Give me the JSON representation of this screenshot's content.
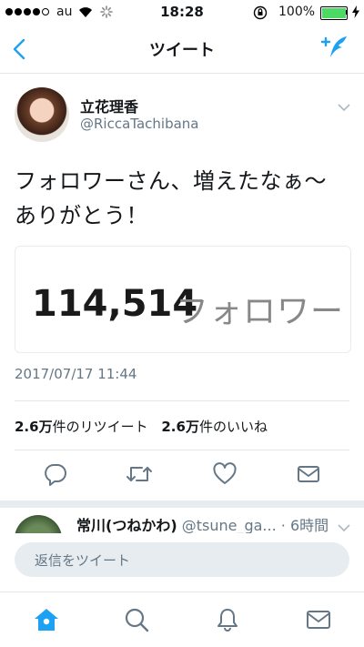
{
  "status_bar": {
    "carrier": "au",
    "time": "18:28",
    "battery_percent": "100%",
    "battery_level": 1.0,
    "signal_dots_filled": 4,
    "signal_dots_total": 5
  },
  "nav": {
    "title": "ツイート"
  },
  "tweet": {
    "display_name": "立花理香",
    "handle": "@RiccaTachibana",
    "text_line1": "フォロワーさん、増えたなぁ〜",
    "text_line2": "ありがとう！",
    "media_count": "114,514",
    "media_label": "フォロワー",
    "timestamp": "2017/07/17 11:44",
    "retweet_count": "2.6万",
    "retweet_label": "件のリツイート",
    "like_count": "2.6万",
    "like_label": "件のいいね"
  },
  "reply": {
    "name": "常川(つねかわ)",
    "handle": "@tsune_ga...",
    "time": "· 6時間"
  },
  "composer": {
    "placeholder": "返信をツイート"
  },
  "colors": {
    "accent": "#1da1f2",
    "secondary_text": "#657786",
    "divider": "#e1e8ed",
    "battery_green": "#4cd964"
  },
  "icons": {
    "back": "chevron-left-icon",
    "compose": "compose-tweet-icon",
    "reply": "reply-icon",
    "retweet": "retweet-icon",
    "like": "heart-icon",
    "dm": "envelope-icon",
    "home": "home-icon",
    "search": "search-icon",
    "notifications": "bell-icon",
    "messages": "envelope-icon"
  }
}
